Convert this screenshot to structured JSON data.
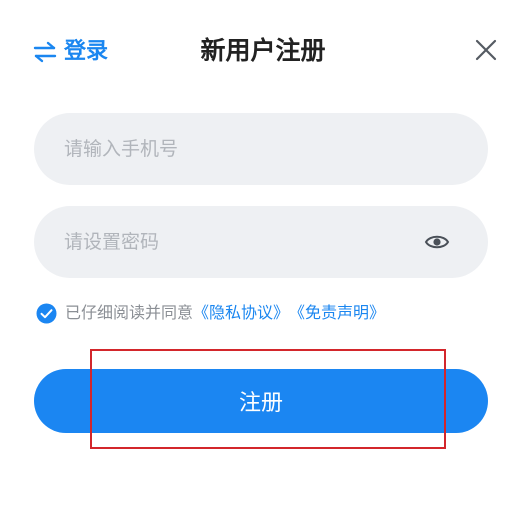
{
  "header": {
    "login_label": "登录",
    "title": "新用户注册",
    "login_icon": "switch-arrows-icon",
    "close_icon": "close-icon"
  },
  "form": {
    "phone_placeholder": "请输入手机号",
    "phone_value": "",
    "password_placeholder": "请设置密码",
    "password_value": "",
    "password_visibility_icon": "eye-icon"
  },
  "agreement": {
    "checked": true,
    "text": "已仔细阅读并同意",
    "privacy_link": "《隐私协议》",
    "disclaimer_link": "《免责声明》"
  },
  "actions": {
    "register_label": "注册"
  },
  "colors": {
    "accent": "#1b86f2",
    "field_background": "#eef0f3",
    "highlight": "#d3262b"
  }
}
